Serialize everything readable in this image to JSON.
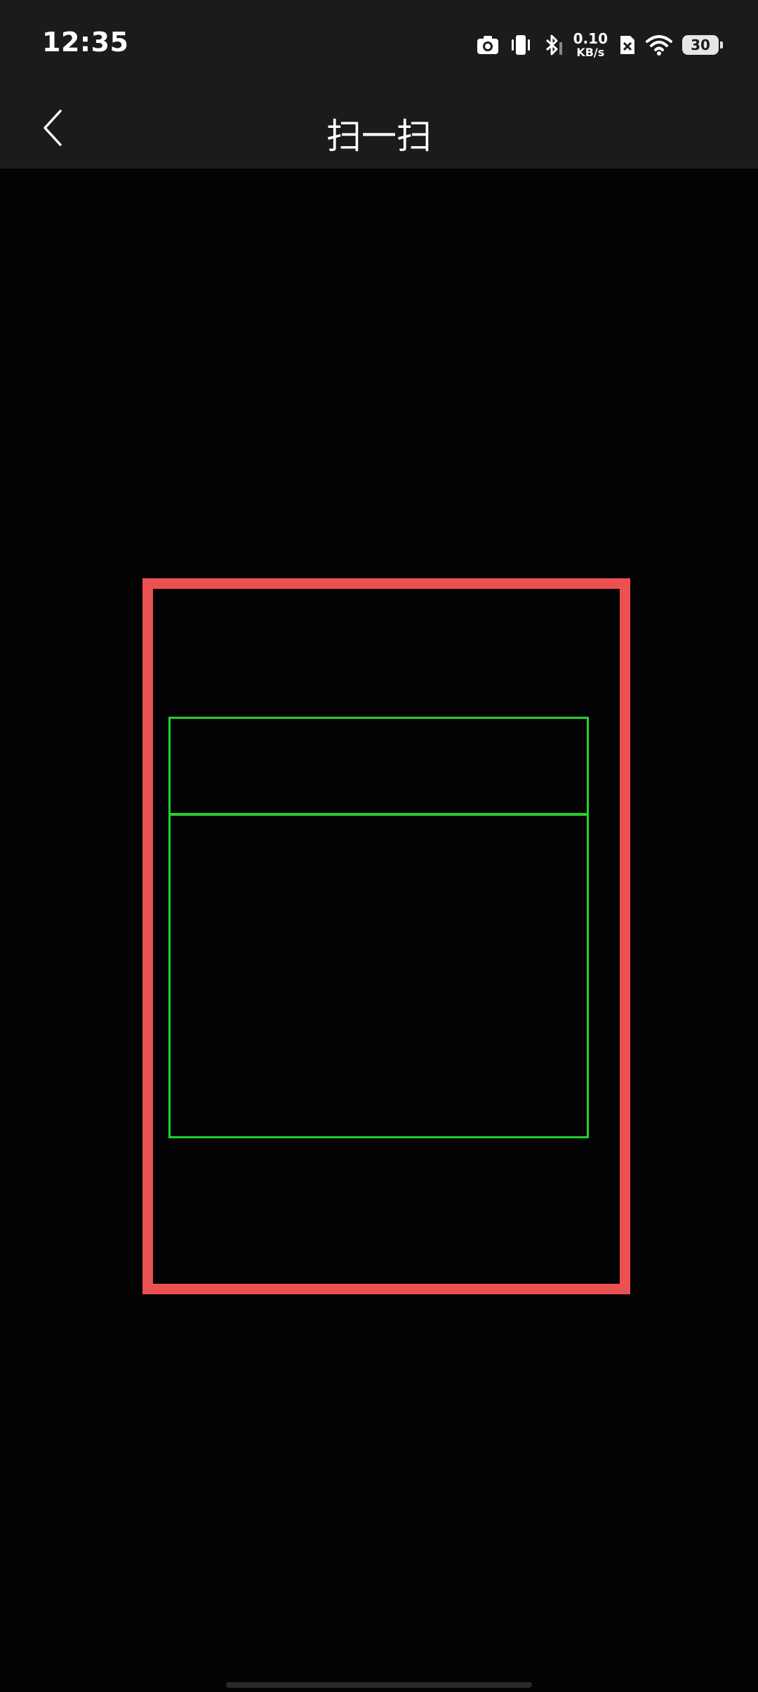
{
  "status_bar": {
    "time": "12:35",
    "net_speed_value": "0.10",
    "net_speed_unit": "KB/s",
    "battery_level": "30",
    "icons": [
      "camera-icon",
      "vibrate-icon",
      "bluetooth-icon",
      "net-speed",
      "sim-error-icon",
      "wifi-icon",
      "battery-icon"
    ]
  },
  "header": {
    "title": "扫一扫",
    "back_icon": "chevron-left-icon"
  },
  "scanner": {
    "frame_color": "#eb5150",
    "detection_color": "#23d12b"
  }
}
